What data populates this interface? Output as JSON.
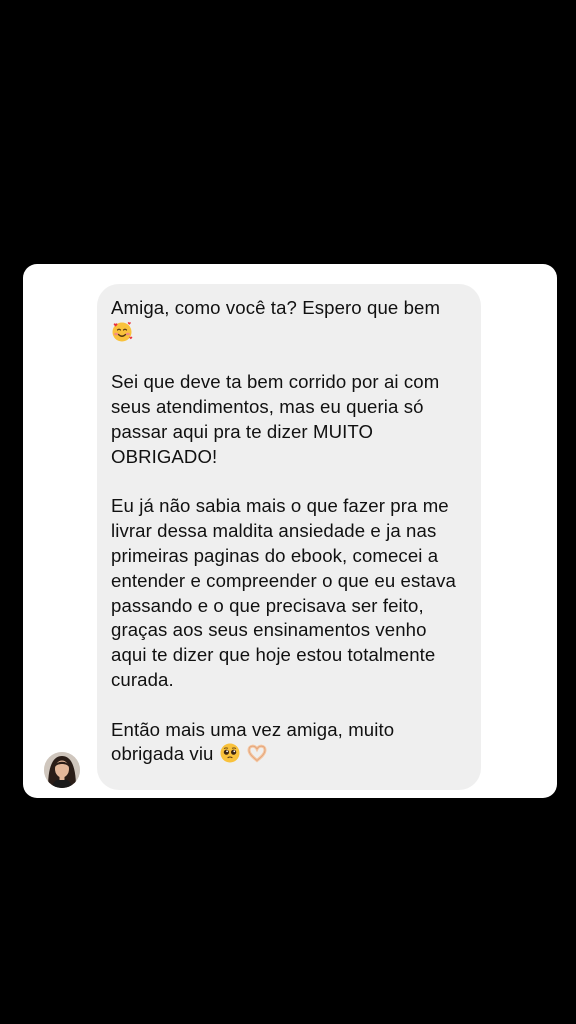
{
  "message": {
    "paragraphs": [
      {
        "text": "Amiga, como você ta? Espero que bem\n",
        "emoji": "smiling-face-with-hearts-icon"
      },
      {
        "text": "Sei que deve ta bem corrido por ai com seus atendimentos, mas eu queria só passar aqui pra te dizer MUITO OBRIGADO!"
      },
      {
        "text": "Eu já não sabia mais o que fazer pra me livrar dessa maldita ansiedade e ja nas primeiras paginas do ebook, comecei a entender e compreender o que eu estava passando e o que precisava ser feito, graças aos seus ensinamentos venho aqui te dizer que hoje estou totalmente curada."
      },
      {
        "text": "Então mais uma vez amiga, muito obrigada viu ",
        "emojis": [
          "pleading-face-icon",
          "heart-hands-icon"
        ]
      }
    ]
  },
  "colors": {
    "background": "#000000",
    "card": "#ffffff",
    "bubble": "#efefef",
    "text": "#111111"
  },
  "icons": {
    "avatar": "profile-avatar"
  }
}
